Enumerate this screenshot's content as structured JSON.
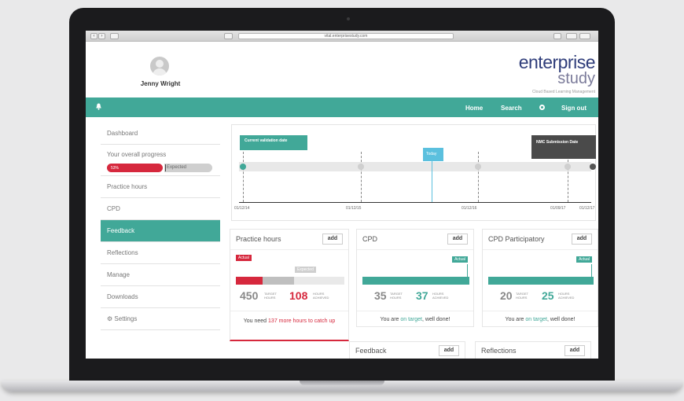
{
  "browser": {
    "url": "vital.enterprisestudy.com"
  },
  "user": {
    "name": "Jenny Wright"
  },
  "logo": {
    "line1": "enterprise",
    "line2": "study",
    "tagline": "Cloud Based Learning Management"
  },
  "nav": {
    "home": "Home",
    "search": "Search",
    "signout": "Sign out"
  },
  "sidebar": {
    "items": [
      {
        "label": "Dashboard"
      },
      {
        "label": "Your overall progress"
      },
      {
        "label": "Practice hours"
      },
      {
        "label": "CPD"
      },
      {
        "label": "Feedback"
      },
      {
        "label": "Reflections"
      },
      {
        "label": "Manage"
      },
      {
        "label": "Downloads"
      },
      {
        "label": "Settings"
      }
    ],
    "active": "Feedback",
    "progress": {
      "value_label": "53%",
      "value": 0.53,
      "expected_label": "Expected"
    }
  },
  "timeline": {
    "flags": {
      "validation": "Current validation date",
      "today": "Today",
      "submission": "NMC Submission Date"
    },
    "dates": [
      "01/12/14",
      "01/12/15",
      "01/12/16",
      "01/09/17",
      "01/12/17"
    ]
  },
  "cards": {
    "practice": {
      "title": "Practice hours",
      "add": "add",
      "actual": "Actual",
      "expected": "Expected",
      "target": "450",
      "target_label": "TARGET HOURS",
      "achieved": "108",
      "achieved_label": "HOURS ACHIEVED",
      "msg_pre": "You need ",
      "msg_highlight": "137 more hours to catch up",
      "msg_post": ""
    },
    "cpd": {
      "title": "CPD",
      "add": "add",
      "actual": "Actual",
      "target": "35",
      "target_label": "TARGET HOURS",
      "achieved": "37",
      "achieved_label": "HOURS ACHIEVED",
      "msg_pre": "You are ",
      "msg_highlight": "on target",
      "msg_post": ", well done!"
    },
    "cpd_part": {
      "title": "CPD Participatory",
      "add": "add",
      "actual": "Actual",
      "target": "20",
      "target_label": "TARGET HOURS",
      "achieved": "25",
      "achieved_label": "HOURS ACHIEVED",
      "msg_pre": "You are ",
      "msg_highlight": "on target",
      "msg_post": ", well done!"
    },
    "feedback": {
      "title": "Feedback",
      "add": "add"
    },
    "reflections": {
      "title": "Reflections",
      "add": "add"
    }
  },
  "colors": {
    "teal": "#41a898",
    "red": "#d6283d",
    "today": "#5bc0de",
    "navy": "#2f3d7a"
  }
}
